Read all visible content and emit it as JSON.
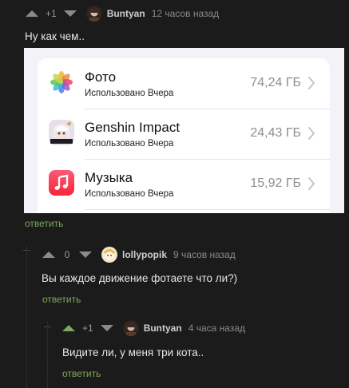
{
  "comments": [
    {
      "rating": "+1",
      "user": "Buntyan",
      "time": "12 часов назад",
      "text": "Ну как чем..",
      "reply": "ответить"
    },
    {
      "rating": "0",
      "user": "lollypopik",
      "time": "9 часов назад",
      "text": "Вы каждое движение фотаете что ли?)",
      "reply": "ответить"
    },
    {
      "rating": "+1",
      "user": "Buntyan",
      "time": "4 часа назад",
      "text": "Видите ли, у меня три кота..",
      "reply": "ответить"
    }
  ],
  "storage_screenshot": {
    "apps": [
      {
        "name": "Фото",
        "subtitle": "Использовано Вчера",
        "size": "74,24 ГБ",
        "icon": "photos-icon"
      },
      {
        "name": "Genshin Impact",
        "subtitle": "Использовано Вчера",
        "size": "24,43 ГБ",
        "icon": "genshin-icon"
      },
      {
        "name": "Музыка",
        "subtitle": "Использовано Вчера",
        "size": "15,92 ГБ",
        "icon": "music-icon"
      }
    ]
  },
  "colors": {
    "background": "#1b1b1b",
    "accent_green": "#7ea85a",
    "muted": "#8a8a8a"
  }
}
